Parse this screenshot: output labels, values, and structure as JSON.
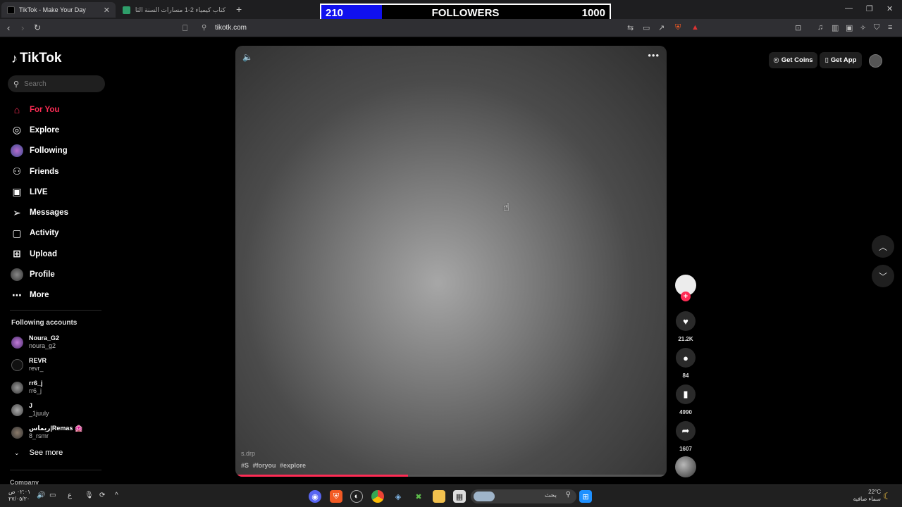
{
  "browser": {
    "tabs": [
      {
        "title": "TikTok - Make Your Day",
        "active": true
      },
      {
        "title": "كتاب كيمياء 2-1 مسارات السنة الثانية الـ",
        "active": false
      }
    ],
    "url": "tikotk.com"
  },
  "overlay": {
    "current": "210",
    "label": "FOLLOWERS",
    "goal": "1000",
    "progress_fraction": 0.21,
    "fill_color": "#1010ee"
  },
  "sidebar": {
    "logo": "TikTok",
    "search_placeholder": "Search",
    "menu": [
      {
        "label": "For You",
        "icon": "home-icon",
        "active": true
      },
      {
        "label": "Explore",
        "icon": "compass-icon"
      },
      {
        "label": "Following",
        "icon": "following-avatar-icon"
      },
      {
        "label": "Friends",
        "icon": "friends-icon"
      },
      {
        "label": "LIVE",
        "icon": "live-icon"
      },
      {
        "label": "Messages",
        "icon": "messages-icon"
      },
      {
        "label": "Activity",
        "icon": "activity-icon"
      },
      {
        "label": "Upload",
        "icon": "upload-icon"
      },
      {
        "label": "Profile",
        "icon": "profile-avatar-icon"
      },
      {
        "label": "More",
        "icon": "more-icon"
      }
    ],
    "following_heading": "Following accounts",
    "accounts": [
      {
        "name": "Noura_G2",
        "handle": "noura_g2"
      },
      {
        "name": "REVR",
        "handle": "revr_"
      },
      {
        "name": "rr6_j",
        "handle": "rr6_j"
      },
      {
        "name": "J",
        "handle": "_1juuly"
      },
      {
        "name": "ريماس|Remas 🏩",
        "handle": "8_rsmr"
      }
    ],
    "see_more": "See more",
    "company": "Company"
  },
  "video": {
    "username": "s.drp",
    "hashtags": "#S #foryou #explore",
    "progress_fraction": 0.4
  },
  "actions": {
    "likes": "21.2K",
    "comments": "84",
    "saves": "4990",
    "shares": "1607"
  },
  "topright": {
    "get_coins": "Get Coins",
    "get_app": "Get App"
  },
  "taskbar": {
    "search_text": "بحث",
    "time": "٠٢:٠١ ص",
    "date": "٢٧/٠٥/٢٠",
    "temperature": "22°C",
    "weather": "سماء صافية"
  },
  "colors": {
    "accent": "#fe2c55"
  }
}
